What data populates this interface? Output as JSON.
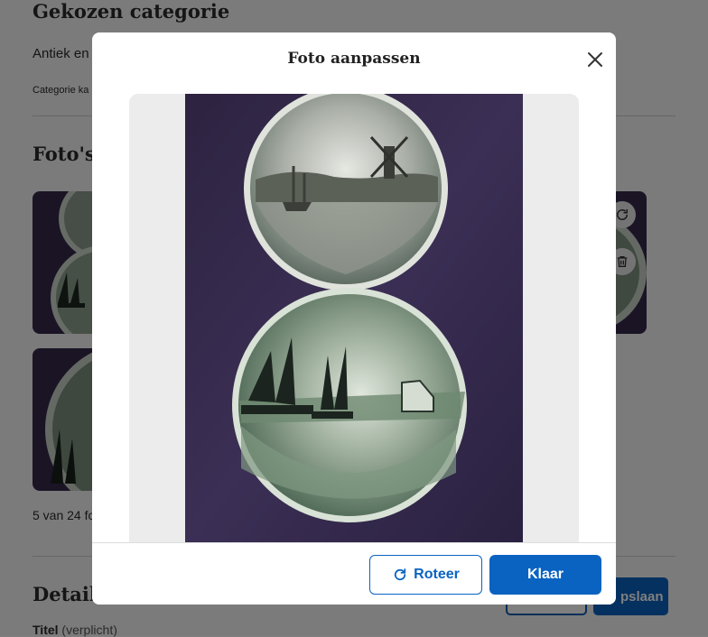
{
  "background_page": {
    "category_heading": "Gekozen categorie",
    "category_value": "Antiek en",
    "category_link": "Categorie ka",
    "photos_heading": "Foto's",
    "photos_count": "5 van 24 fo",
    "details_heading": "Detail",
    "title_label": "Titel",
    "title_required": "(verplicht)",
    "save_button_partial": "pslaan"
  },
  "modal": {
    "title": "Foto aanpassen",
    "rotate_label": "Roteer",
    "done_label": "Klaar"
  },
  "colors": {
    "primary": "#0a63c1",
    "overlay": "rgba(0,0,0,0.5)",
    "photo_background": "#35284a",
    "image_area": "#ececec"
  },
  "icons": {
    "close": "close-icon",
    "rotate": "rotate-icon",
    "thumbnail_rotate": "rotate-icon",
    "thumbnail_delete": "trash-icon"
  }
}
